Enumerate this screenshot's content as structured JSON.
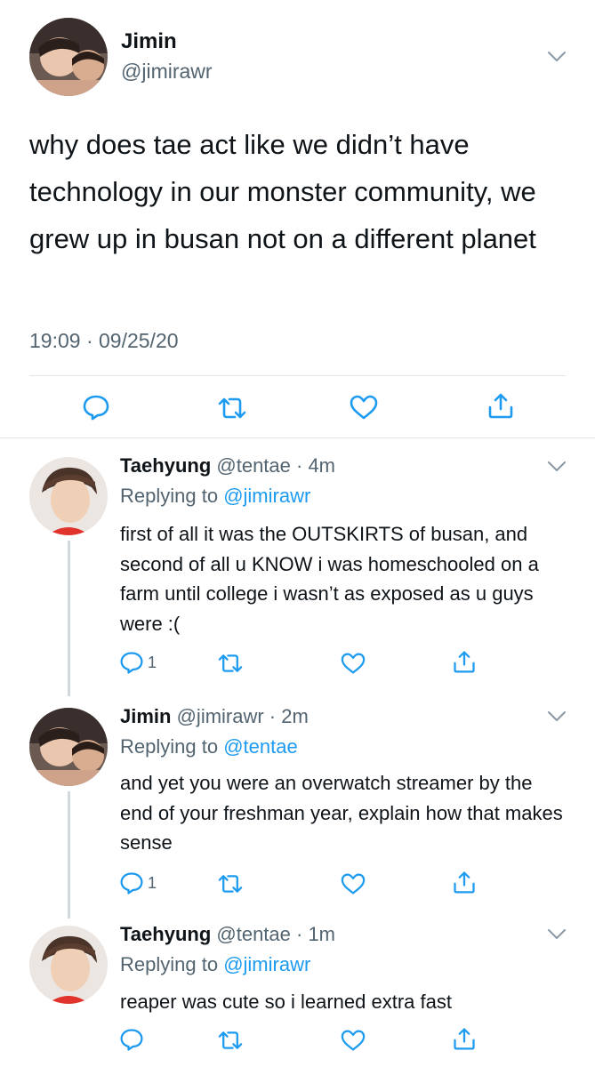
{
  "main_tweet": {
    "name": "Jimin",
    "handle": "@jimirawr",
    "text": "why does tae act like we didn’t have technology in our monster community, we grew up in busan not on a different planet",
    "timestamp": "19:09 · 09/25/20",
    "actions": [
      "reply-icon",
      "retweet-icon",
      "like-icon",
      "share-icon"
    ]
  },
  "replies": [
    {
      "name": "Taehyung",
      "meta": "@tentae · 4m",
      "replying_prefix": "Replying to",
      "replying_to": "@jimirawr",
      "text": "first of all it was the OUTSKIRTS of busan, and second of all u KNOW i was homeschooled on a farm until college i wasn’t as exposed as u guys were :(",
      "reply_count": "1"
    },
    {
      "name": "Jimin",
      "meta": "@jimirawr · 2m",
      "replying_prefix": "Replying to",
      "replying_to": "@tentae",
      "text": "and yet you were an overwatch streamer by the end of your freshman year, explain how that makes sense",
      "reply_count": "1"
    },
    {
      "name": "Taehyung",
      "meta": "@tentae · 1m",
      "replying_prefix": "Replying to",
      "replying_to": "@jimirawr",
      "text": "reaper was cute so i learned extra fast",
      "reply_count": ""
    }
  ],
  "colors": {
    "text": "#0f1419",
    "secondary": "#536471",
    "link": "#1d9bf0",
    "divider": "#e1e6ea",
    "thread_line": "#cfd9de"
  }
}
